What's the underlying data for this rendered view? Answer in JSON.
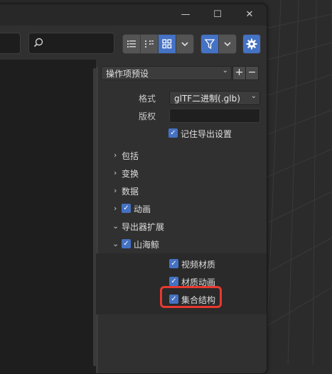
{
  "window": {
    "controls": {
      "minimize": "—",
      "maximize": "☐",
      "close": "✕"
    }
  },
  "toolbar": {
    "search_placeholder": "",
    "view_buttons": [
      "list-vertical-view",
      "list-horizontal-view",
      "thumbnail-view"
    ],
    "accent_color": "#4472c4"
  },
  "panel": {
    "preset_label": "操作项预设",
    "add_label": "+",
    "remove_label": "−",
    "format_label": "格式",
    "format_value": "glTF二进制(.glb)",
    "copyright_label": "版权",
    "copyright_value": "",
    "remember_label": "记住导出设置",
    "sections": {
      "include": "包括",
      "transform": "变换",
      "data": "数据",
      "animation": "动画",
      "exporter_ext": "导出器扩展",
      "shanhaijing": "山海鲸"
    },
    "ext_options": {
      "video_material": "视频材质",
      "material_animation": "材质动画",
      "collection_structure": "集合结构"
    }
  }
}
